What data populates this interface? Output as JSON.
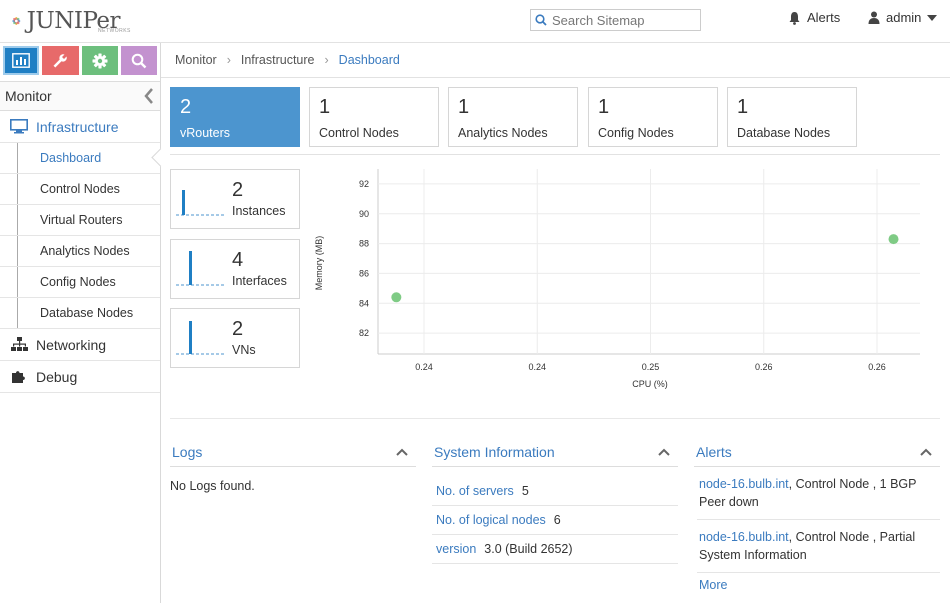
{
  "header": {
    "brand": "JUNIPer",
    "brand_sub": "NETWORKS",
    "search_placeholder": "Search Sitemap",
    "alerts_label": "Alerts",
    "user_label": "admin"
  },
  "sidebar": {
    "section_title": "Monitor",
    "items": [
      {
        "label": "Infrastructure",
        "icon": "monitor-icon"
      },
      {
        "label": "Networking",
        "icon": "network-icon"
      },
      {
        "label": "Debug",
        "icon": "puzzle-icon"
      }
    ],
    "subitems": [
      {
        "label": "Dashboard"
      },
      {
        "label": "Control Nodes"
      },
      {
        "label": "Virtual Routers"
      },
      {
        "label": "Analytics Nodes"
      },
      {
        "label": "Config Nodes"
      },
      {
        "label": "Database Nodes"
      }
    ]
  },
  "breadcrumb": {
    "items": [
      "Monitor",
      "Infrastructure",
      "Dashboard"
    ]
  },
  "stats": [
    {
      "value": "2",
      "label": "vRouters"
    },
    {
      "value": "1",
      "label": "Control Nodes"
    },
    {
      "value": "1",
      "label": "Analytics Nodes"
    },
    {
      "value": "1",
      "label": "Config Nodes"
    },
    {
      "value": "1",
      "label": "Database Nodes"
    }
  ],
  "mini_stats": [
    {
      "value": "2",
      "label": "Instances"
    },
    {
      "value": "4",
      "label": "Interfaces"
    },
    {
      "value": "2",
      "label": "VNs"
    }
  ],
  "chart_data": {
    "type": "scatter",
    "xlabel": "CPU (%)",
    "ylabel": "Memory (MB)",
    "x_ticks": [
      "0.24",
      "0.24",
      "0.25",
      "0.26",
      "0.26"
    ],
    "y_ticks": [
      "92",
      "90",
      "88",
      "86",
      "84",
      "82"
    ],
    "xlim": [
      0.2367,
      0.2633
    ],
    "ylim": [
      80.6,
      93.0
    ],
    "points": [
      {
        "x": 0.2376,
        "y": 84.4
      },
      {
        "x": 0.262,
        "y": 88.3
      }
    ],
    "point_color": "#7fcb85",
    "grid": true
  },
  "panels": {
    "logs": {
      "title": "Logs",
      "empty": "No Logs found."
    },
    "system": {
      "title": "System Information",
      "rows": [
        {
          "key": "No. of servers",
          "value": "5"
        },
        {
          "key": "No. of logical nodes",
          "value": "6"
        },
        {
          "key": "version",
          "value": "3.0 (Build 2652)"
        }
      ]
    },
    "alerts": {
      "title": "Alerts",
      "items": [
        {
          "node": "node-16.bulb.int",
          "text": ", Control Node , 1 BGP Peer down"
        },
        {
          "node": "node-16.bulb.int",
          "text": ", Control Node , Partial System Information"
        }
      ],
      "more": "More"
    }
  },
  "colors": {
    "accent": "#3b7bbf",
    "active_tile": "#4c95cf"
  }
}
